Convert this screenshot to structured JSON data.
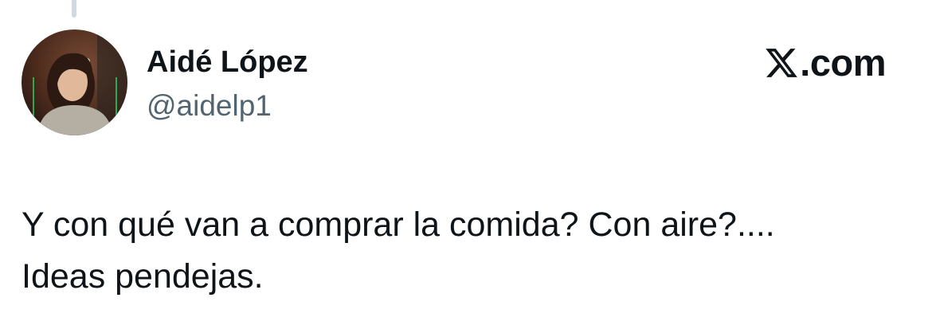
{
  "tweet": {
    "author": {
      "display_name": "Aidé López",
      "handle": "@aidelp1",
      "avatar": "profile-photo"
    },
    "brand": {
      "icon": "x-logo-icon",
      "text": ".com"
    },
    "text_lines": [
      "Y con qué van a comprar la comida? Con aire?....",
      "Ideas pendejas."
    ]
  }
}
